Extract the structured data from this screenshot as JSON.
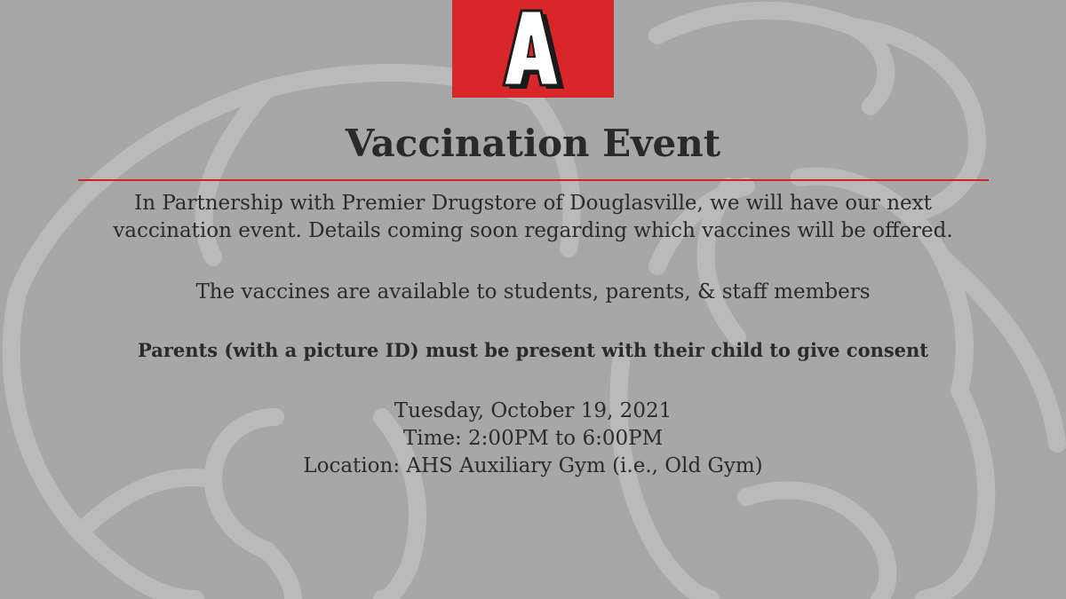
{
  "logo": {
    "letter": "A",
    "background_color": "#d9262b",
    "icon": "school-letter-a-logo"
  },
  "background": {
    "watermark": "mascot-outline-watermark",
    "color": "#a7a7a7"
  },
  "title": "Vaccination Event",
  "intro_lines": [
    "In Partnership with Premier Drugstore of Douglasville, we will have our next",
    "vaccination event. Details coming soon regarding which vaccines will be offered."
  ],
  "availability": "The vaccines are available to students, parents, & staff members",
  "consent_notice": "Parents (with a picture ID) must be present with their child to give consent",
  "event_details": {
    "date": "Tuesday, October 19, 2021",
    "time": "Time: 2:00PM to 6:00PM",
    "location": "Location: AHS Auxiliary Gym (i.e., Old Gym)"
  },
  "colors": {
    "accent": "#d9262b",
    "text": "#2b2b2b"
  }
}
